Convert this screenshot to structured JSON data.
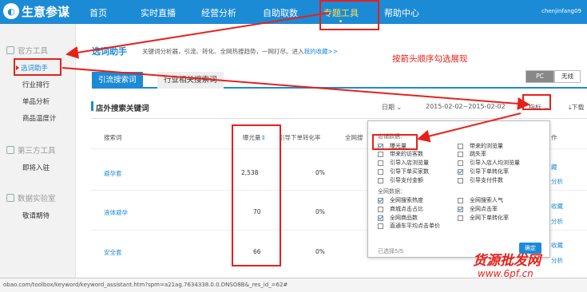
{
  "nav": {
    "logo_text": "生意参谋",
    "items": [
      "首页",
      "实时直播",
      "经营分析",
      "自助取数",
      "专题工具",
      "帮助中心"
    ],
    "user": "chenjinfang09"
  },
  "sidebar": {
    "group1": "官方工具",
    "group1_items": [
      "选词助手",
      "行业排行",
      "单品分析",
      "商品温度计"
    ],
    "group2": "第三方工具",
    "group2_items": [
      "即将入驻"
    ],
    "group3": "数据实验室",
    "group3_items": [
      "敬请期待"
    ]
  },
  "page": {
    "title": "选词助手",
    "desc": "关键词分析器，引流、转化、全网热搜趋势，一网打尽。进入",
    "desc_link": "我的收藏>>",
    "annotation": "按箭头顺序勾选展现",
    "tabs": [
      "引流搜索词",
      "行业相关搜索词"
    ],
    "device": [
      "PC",
      "无线"
    ]
  },
  "section": {
    "title": "店外搜索关键词",
    "date_label": "日期",
    "date_range": "2015-02-02~2015-02-02",
    "metric_label": "指标",
    "download_label": "下载"
  },
  "table": {
    "headers": [
      "搜索词",
      "曝光量",
      "引导下单转化率",
      "全网搜"
    ],
    "action_header": "作",
    "rows": [
      {
        "keyword": "避孕套",
        "exposure": "2,538",
        "rate": "0%"
      },
      {
        "keyword": "液体避孕",
        "exposure": "70",
        "rate": "0%"
      },
      {
        "keyword": "安全套",
        "exposure": "66",
        "rate": "0%"
      }
    ],
    "actions": [
      "藏",
      "分析",
      "收藏",
      "分析",
      "收藏",
      "分析"
    ]
  },
  "popup": {
    "group1": "店铺数据：",
    "group1_options": [
      {
        "label": "曝光量",
        "checked": true
      },
      {
        "label": "带来的浏览量",
        "checked": false
      },
      {
        "label": "带来的访客数",
        "checked": false
      },
      {
        "label": "跳失率",
        "checked": false
      },
      {
        "label": "引导入店浏览量",
        "checked": false
      },
      {
        "label": "引导入店人均浏览量",
        "checked": false
      },
      {
        "label": "引导下单买家数",
        "checked": false
      },
      {
        "label": "引导下单转化率",
        "checked": true
      },
      {
        "label": "引导支付金额",
        "checked": false
      },
      {
        "label": "引导支付件数",
        "checked": false
      }
    ],
    "group2": "全网数据：",
    "group2_options": [
      {
        "label": "全网搜索热度",
        "checked": true
      },
      {
        "label": "全网搜索人气",
        "checked": false
      },
      {
        "label": "商城点击占比",
        "checked": false
      },
      {
        "label": "全网点击率",
        "checked": true
      },
      {
        "label": "全网商品数",
        "checked": true
      },
      {
        "label": "全网下单转化率",
        "checked": false
      },
      {
        "label": "直通车平均点击单价",
        "checked": false
      }
    ],
    "selected_count": "已选择5/5",
    "confirm": "确定"
  },
  "status": {
    "url": "obao.com/toolbox/keyword/keyword_assistant.htm?spm=a21ag.7634338.0.0.DNSO8B&_res_id_=62#"
  },
  "watermark": {
    "line1": "货源批发网",
    "line2": "www.6pf.cn"
  },
  "colors": {
    "brand": "#1c8bd6",
    "annotation": "#e8201a",
    "highlight": "#ffe14d"
  }
}
